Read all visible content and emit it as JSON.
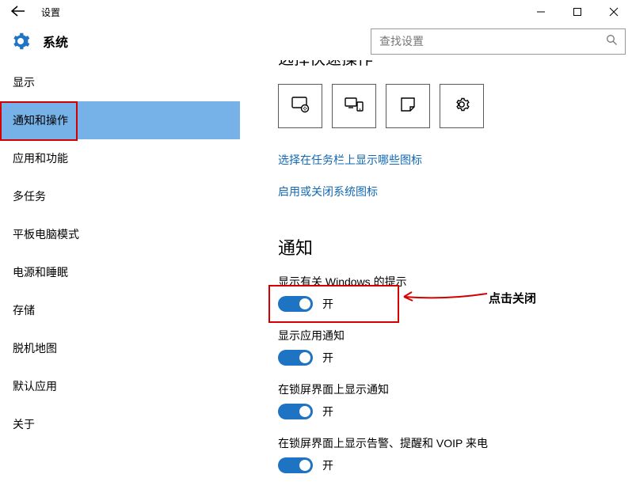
{
  "window": {
    "title": "设置"
  },
  "header": {
    "title": "系统",
    "search_placeholder": "查找设置"
  },
  "sidebar": {
    "items": [
      {
        "label": "显示"
      },
      {
        "label": "通知和操作"
      },
      {
        "label": "应用和功能"
      },
      {
        "label": "多任务"
      },
      {
        "label": "平板电脑模式"
      },
      {
        "label": "电源和睡眠"
      },
      {
        "label": "存储"
      },
      {
        "label": "脱机地图"
      },
      {
        "label": "默认应用"
      },
      {
        "label": "关于"
      }
    ],
    "selected_index": 1
  },
  "content": {
    "truncated_heading": "选择快速操作",
    "links": {
      "taskbar_icons": "选择在任务栏上显示哪些图标",
      "system_icons": "启用或关闭系统图标"
    },
    "section_title": "通知",
    "settings": [
      {
        "label": "显示有关 Windows 的提示",
        "state": "开"
      },
      {
        "label": "显示应用通知",
        "state": "开"
      },
      {
        "label": "在锁屏界面上显示通知",
        "state": "开"
      },
      {
        "label": "在锁屏界面上显示告警、提醒和 VOIP 来电",
        "state": "开"
      }
    ]
  },
  "annotation": {
    "label": "点击关闭"
  }
}
